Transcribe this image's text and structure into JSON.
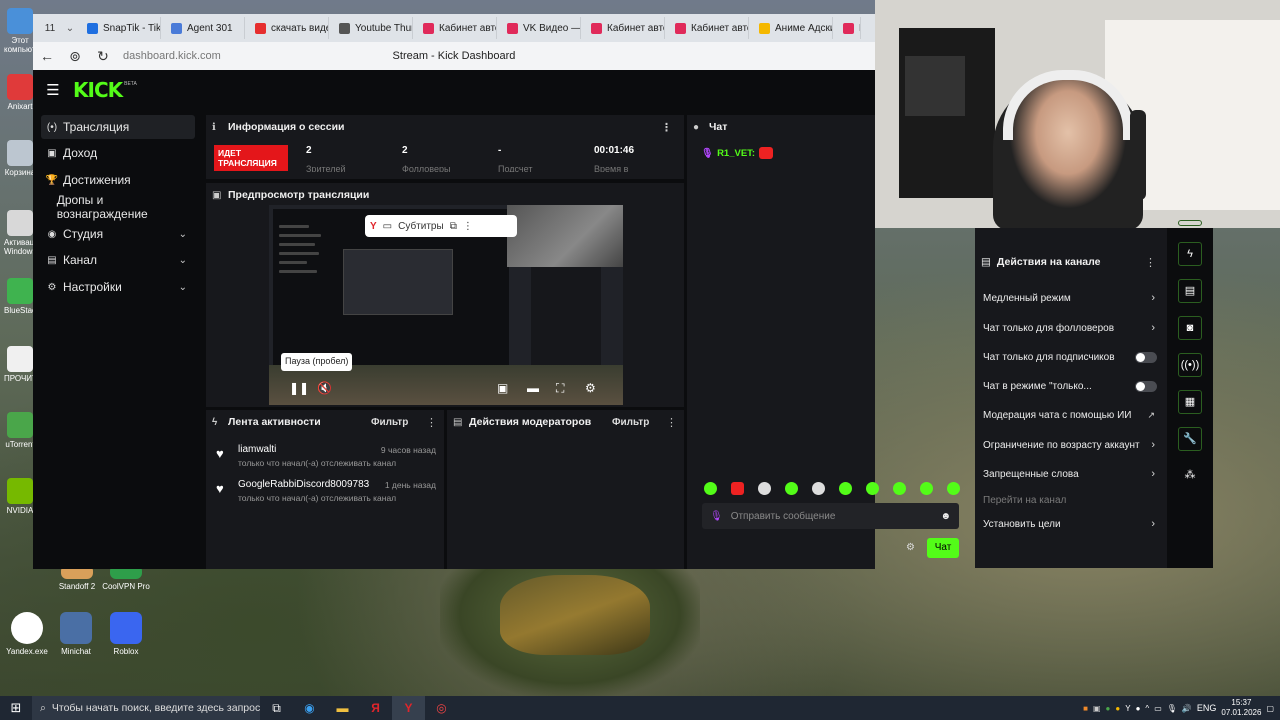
{
  "browser": {
    "tab_count": "11",
    "tabs": [
      {
        "label": "SnapTik - TikT",
        "color": "#1f6fe0"
      },
      {
        "label": "Agent 301",
        "color": "#4a7bd8"
      },
      {
        "label": "скачать виде",
        "color": "#e62e2e"
      },
      {
        "label": "Youtube Thum",
        "color": "#555555"
      },
      {
        "label": "Кабинет авто",
        "color": "#e02a5a"
      },
      {
        "label": "VK Видео — с",
        "color": "#e02a5a"
      },
      {
        "label": "Кабинет авто",
        "color": "#e02a5a"
      },
      {
        "label": "Кабинет авто",
        "color": "#e02a5a"
      },
      {
        "label": "Аниме Адски",
        "color": "#f5b800"
      },
      {
        "label": "П",
        "color": "#e02a5a"
      }
    ],
    "url": "dashboard.kick.com",
    "page_title": "Stream - Kick Dashboard"
  },
  "kick": {
    "logo": "KICK",
    "logo_badge": "BETA",
    "sidebar": [
      {
        "label": "Трансляция",
        "icon": "(•)",
        "active": true,
        "chevron": false
      },
      {
        "label": "Доход",
        "icon": "▣",
        "active": false,
        "chevron": false
      },
      {
        "label": "Достижения",
        "icon": "🏆",
        "active": false,
        "chevron": false
      },
      {
        "label": "Дропы и вознаграждение",
        "icon": "",
        "active": false,
        "chevron": false
      },
      {
        "label": "Студия",
        "icon": "◉",
        "active": false,
        "chevron": true
      },
      {
        "label": "Канал",
        "icon": "▤",
        "active": false,
        "chevron": true
      },
      {
        "label": "Настройки",
        "icon": "⚙",
        "active": false,
        "chevron": true
      }
    ],
    "session": {
      "title": "Информация о сессии",
      "live_label": "ИДЕТ ТРАНСЛЯЦИЯ",
      "stats": [
        {
          "value": "2",
          "label": "Зрителей"
        },
        {
          "value": "2",
          "label": "Фолловеры"
        },
        {
          "value": "-",
          "label": "Подсчет"
        },
        {
          "value": "00:01:46",
          "label": "Время в"
        }
      ]
    },
    "preview": {
      "title": "Предпросмотр трансляции",
      "subtitles_label": "Субтитры",
      "tooltip": "Пауза (пробел)"
    },
    "activity": {
      "title": "Лента активности",
      "filter": "Фильтр",
      "items": [
        {
          "name": "liamwalti",
          "action": "только что начал(-а) отслеживать канал",
          "time": "9 часов назад"
        },
        {
          "name": "GoogleRabbiDiscord8009783",
          "action": "только что начал(-а) отслеживать канал",
          "time": "1 день назад"
        }
      ]
    },
    "mod": {
      "title": "Действия модераторов",
      "filter": "Фильтр"
    },
    "chat": {
      "title": "Чат",
      "messages": [
        {
          "user": "R1_VET:"
        }
      ],
      "placeholder": "Отправить сообщение",
      "send_label": "Чат"
    },
    "channel_actions": {
      "title": "Действия на канале",
      "items": [
        {
          "label": "Медленный режим",
          "control": "arrow"
        },
        {
          "label": "Чат только для фолловеров",
          "control": "arrow"
        },
        {
          "label": "Чат только для подписчиков",
          "control": "toggle"
        },
        {
          "label": "Чат в режиме \"только...",
          "control": "toggle"
        },
        {
          "label": "Модерация чата с помощью ИИ",
          "control": "external"
        },
        {
          "label": "Ограничение по возрасту аккаунт",
          "control": "arrow"
        },
        {
          "label": "Запрещенные слова",
          "control": "arrow"
        },
        {
          "label": "Перейти на канал",
          "control": "none"
        },
        {
          "label": "Установить цели",
          "control": "arrow"
        }
      ]
    }
  },
  "desktop": {
    "left_icons": [
      "Этот компьютер",
      "Anixart",
      "Корзина",
      "Активация Windows",
      "BlueStacks",
      "ПРОЧИТ",
      "uTorrent",
      "NVIDIA"
    ],
    "bottom_icons": [
      {
        "label": "Standoff 2",
        "color": "#d9a05a"
      },
      {
        "label": "CoolVPN Pro",
        "color": "#2e9e4a"
      },
      {
        "label": "Yandex.exe",
        "color": "#e8e8e8"
      },
      {
        "label": "Minichat",
        "color": "#4a6fa5"
      },
      {
        "label": "Roblox",
        "color": "#3a66f0"
      }
    ]
  },
  "taskbar": {
    "search_placeholder": "Чтобы начать поиск, введите здесь запрос",
    "lang": "ENG",
    "time": "15:37",
    "date": "07.01.2026"
  }
}
